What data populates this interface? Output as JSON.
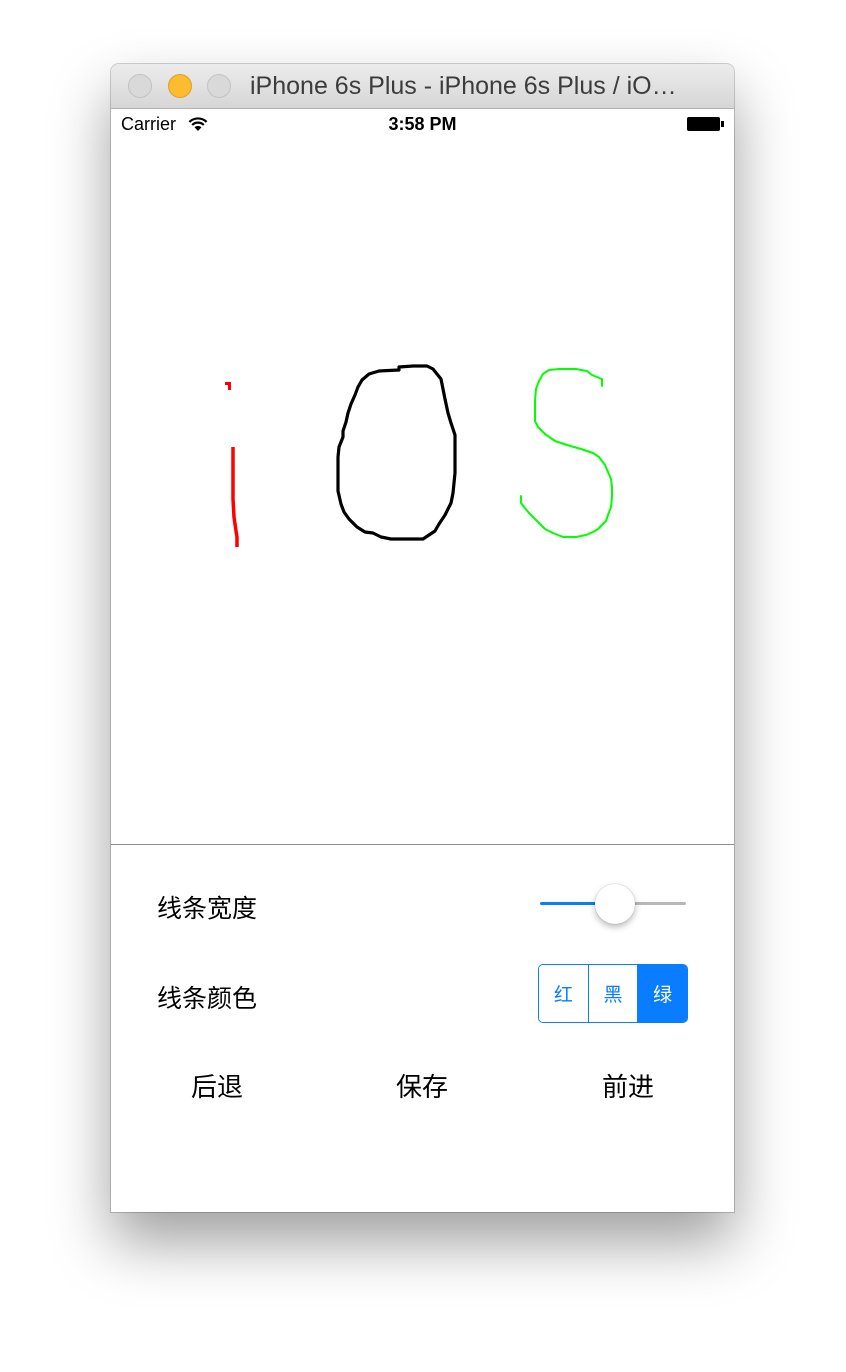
{
  "window": {
    "title": "iPhone 6s Plus - iPhone 6s Plus / iO…"
  },
  "status_bar": {
    "carrier": "Carrier",
    "time": "3:58 PM"
  },
  "drawing": {
    "strokes": [
      {
        "color": "#ff0000",
        "label": "i (red stroke)"
      },
      {
        "color": "#000000",
        "label": "O (black stroke)"
      },
      {
        "color": "#00ff00",
        "label": "S (green stroke)"
      }
    ]
  },
  "controls": {
    "line_width": {
      "label": "线条宽度",
      "slider_value_fraction": 0.5
    },
    "line_color": {
      "label": "线条颜色",
      "segments": [
        "红",
        "黑",
        "绿"
      ],
      "selected": "绿"
    },
    "actions": {
      "back": "后退",
      "save": "保存",
      "forward": "前进"
    }
  },
  "colors": {
    "accent": "#0a7cff",
    "red_stroke": "#ff0000",
    "black_stroke": "#000000",
    "green_stroke": "#00ff00"
  }
}
